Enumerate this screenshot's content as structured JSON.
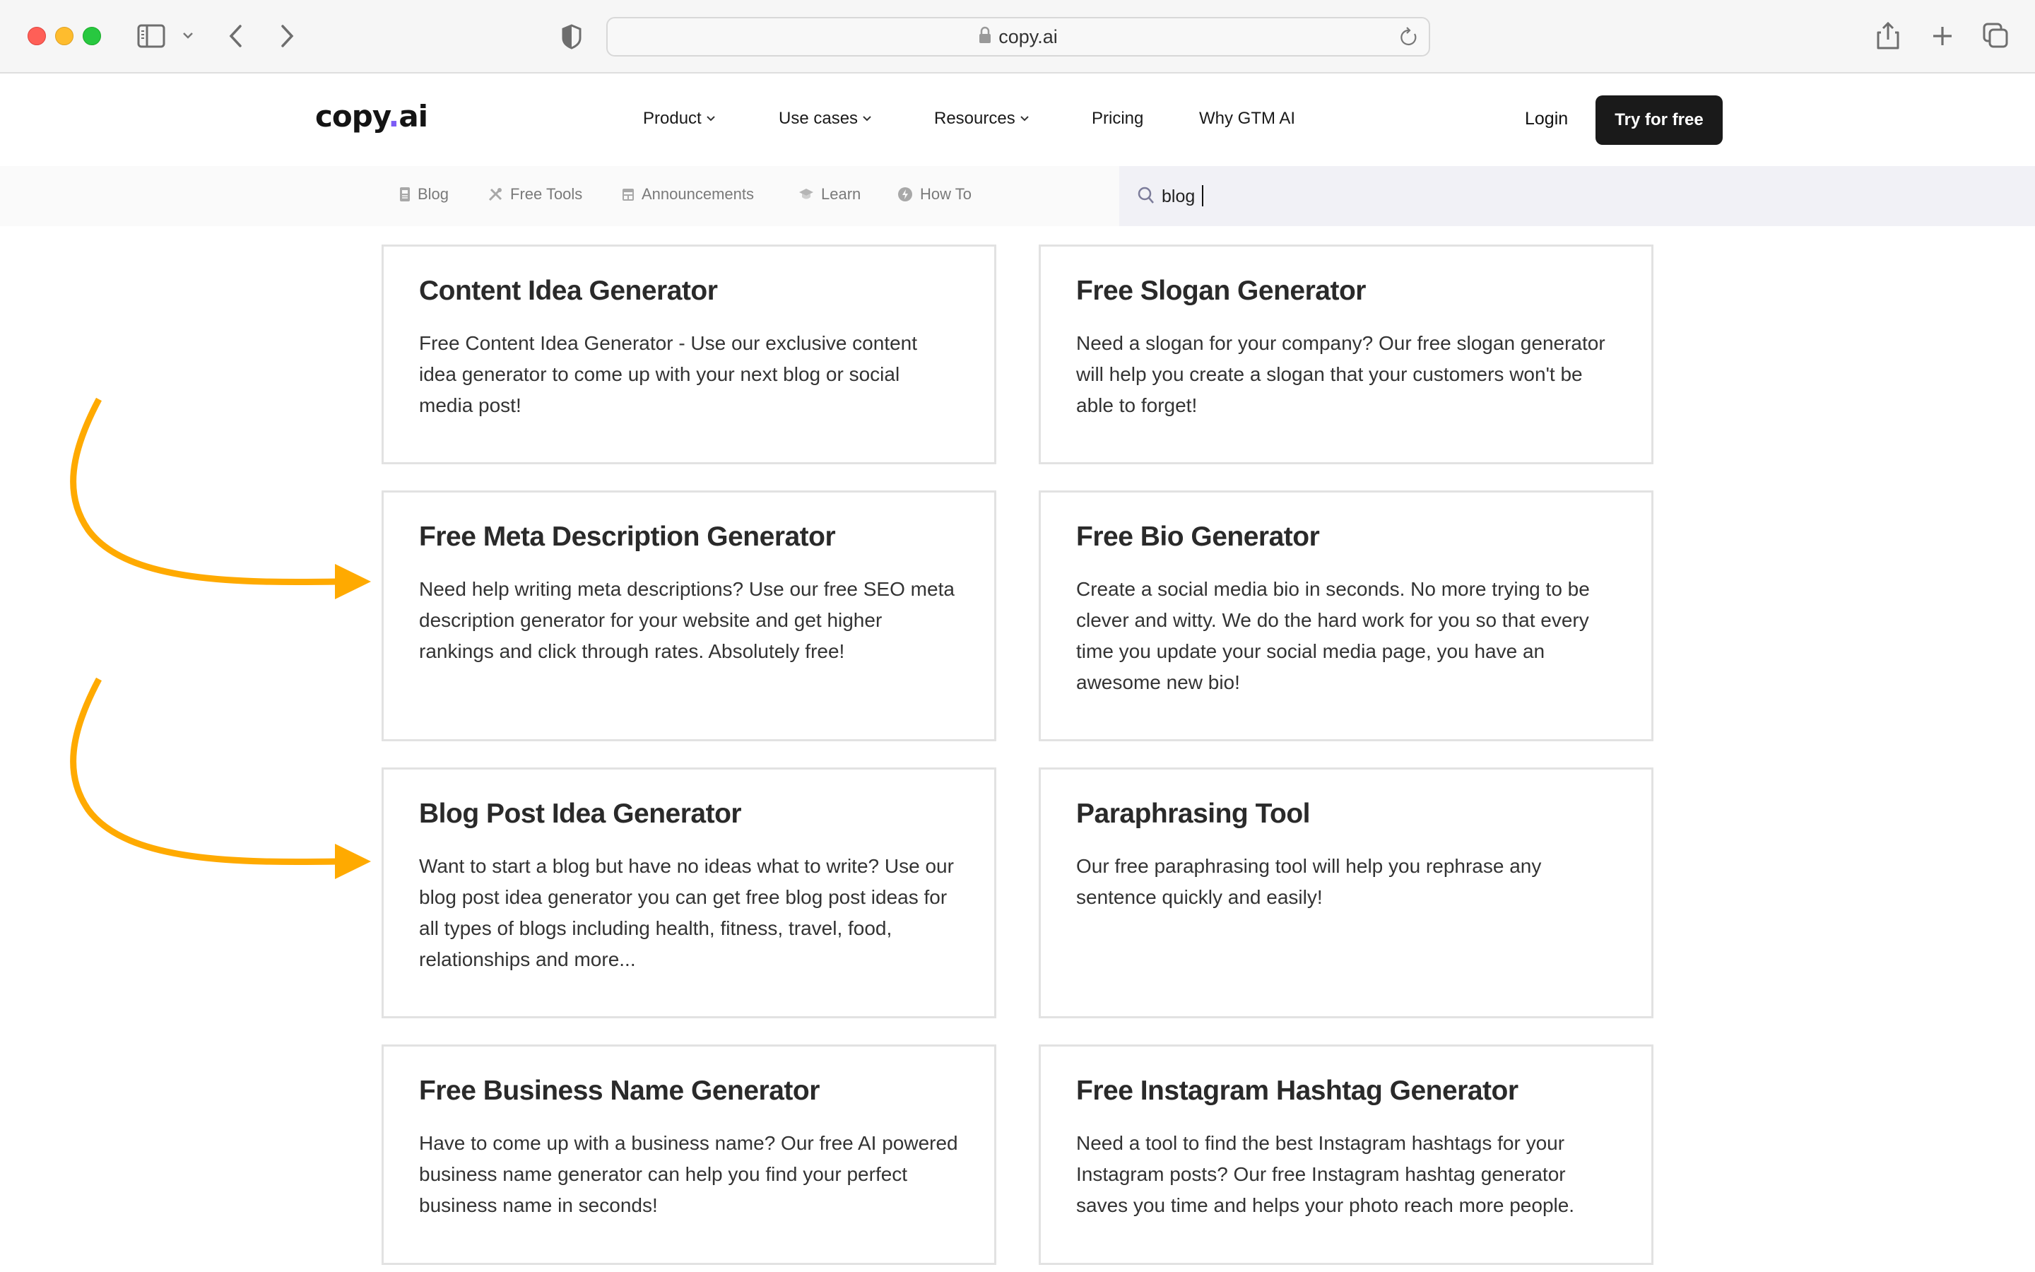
{
  "browser": {
    "url": "copy.ai",
    "icons": [
      "sidebar-icon",
      "chevron-down-icon",
      "back-icon",
      "forward-icon",
      "privacy-shield-icon",
      "lock-icon",
      "reload-icon",
      "share-icon",
      "new-tab-icon",
      "tabs-overview-icon"
    ]
  },
  "site": {
    "logo_main": "copy",
    "logo_dot": ".",
    "logo_suffix": "ai",
    "brand_dot_color": "#7c5cf5",
    "nav": [
      {
        "label": "Product",
        "dropdown": true
      },
      {
        "label": "Use cases",
        "dropdown": true
      },
      {
        "label": "Resources",
        "dropdown": true
      },
      {
        "label": "Pricing",
        "dropdown": false
      },
      {
        "label": "Why GTM AI",
        "dropdown": false
      }
    ],
    "login_label": "Login",
    "cta_label": "Try for free",
    "chevron_glyph": "⌄"
  },
  "subnav": {
    "items": [
      {
        "label": "Blog",
        "icon": "document-icon"
      },
      {
        "label": "Free Tools",
        "icon": "tools-icon"
      },
      {
        "label": "Announcements",
        "icon": "calendar-icon"
      },
      {
        "label": "Learn",
        "icon": "graduation-cap-icon"
      },
      {
        "label": "How To",
        "icon": "lightning-icon"
      }
    ],
    "search": {
      "value": "blog",
      "placeholder": ""
    }
  },
  "cards": [
    {
      "title": "Content Idea Generator",
      "description": "Free Content Idea Generator - Use our exclusive content idea generator to come up with your next blog or social media post!"
    },
    {
      "title": "Free Slogan Generator",
      "description": "Need a slogan for your company? Our free slogan generator will help you create a slogan that your customers won't be able to forget!"
    },
    {
      "title": "Free Meta Description Generator",
      "description": "Need help writing meta descriptions? Use our free SEO meta description generator for your website and get higher rankings and click through rates. Absolutely free!"
    },
    {
      "title": "Free Bio Generator",
      "description": "Create a social media bio in seconds. No more trying to be clever and witty. We do the hard work for you so that every time you update your social media page, you have an awesome new bio!"
    },
    {
      "title": "Blog Post Idea Generator",
      "description": "Want to start a blog but have no ideas what to write? Use our blog post idea generator you can get free blog post ideas for all types of blogs including health, fitness, travel, food, relationships and more..."
    },
    {
      "title": "Paraphrasing Tool",
      "description": "Our free paraphrasing tool will help you rephrase any sentence quickly and easily!"
    },
    {
      "title": "Free Business Name Generator",
      "description": "Have to come up with a business name? Our free AI powered business name generator can help you find your perfect business name in seconds!"
    },
    {
      "title": "Free Instagram Hashtag Generator",
      "description": "Need a tool to find the best Instagram hashtags for your Instagram posts? Our free Instagram hashtag generator saves you time and helps your photo reach more people."
    }
  ],
  "annotations": {
    "arrow_color": "#ffaa00",
    "highlighted_cards": [
      "Free Meta Description Generator",
      "Blog Post Idea Generator"
    ]
  }
}
